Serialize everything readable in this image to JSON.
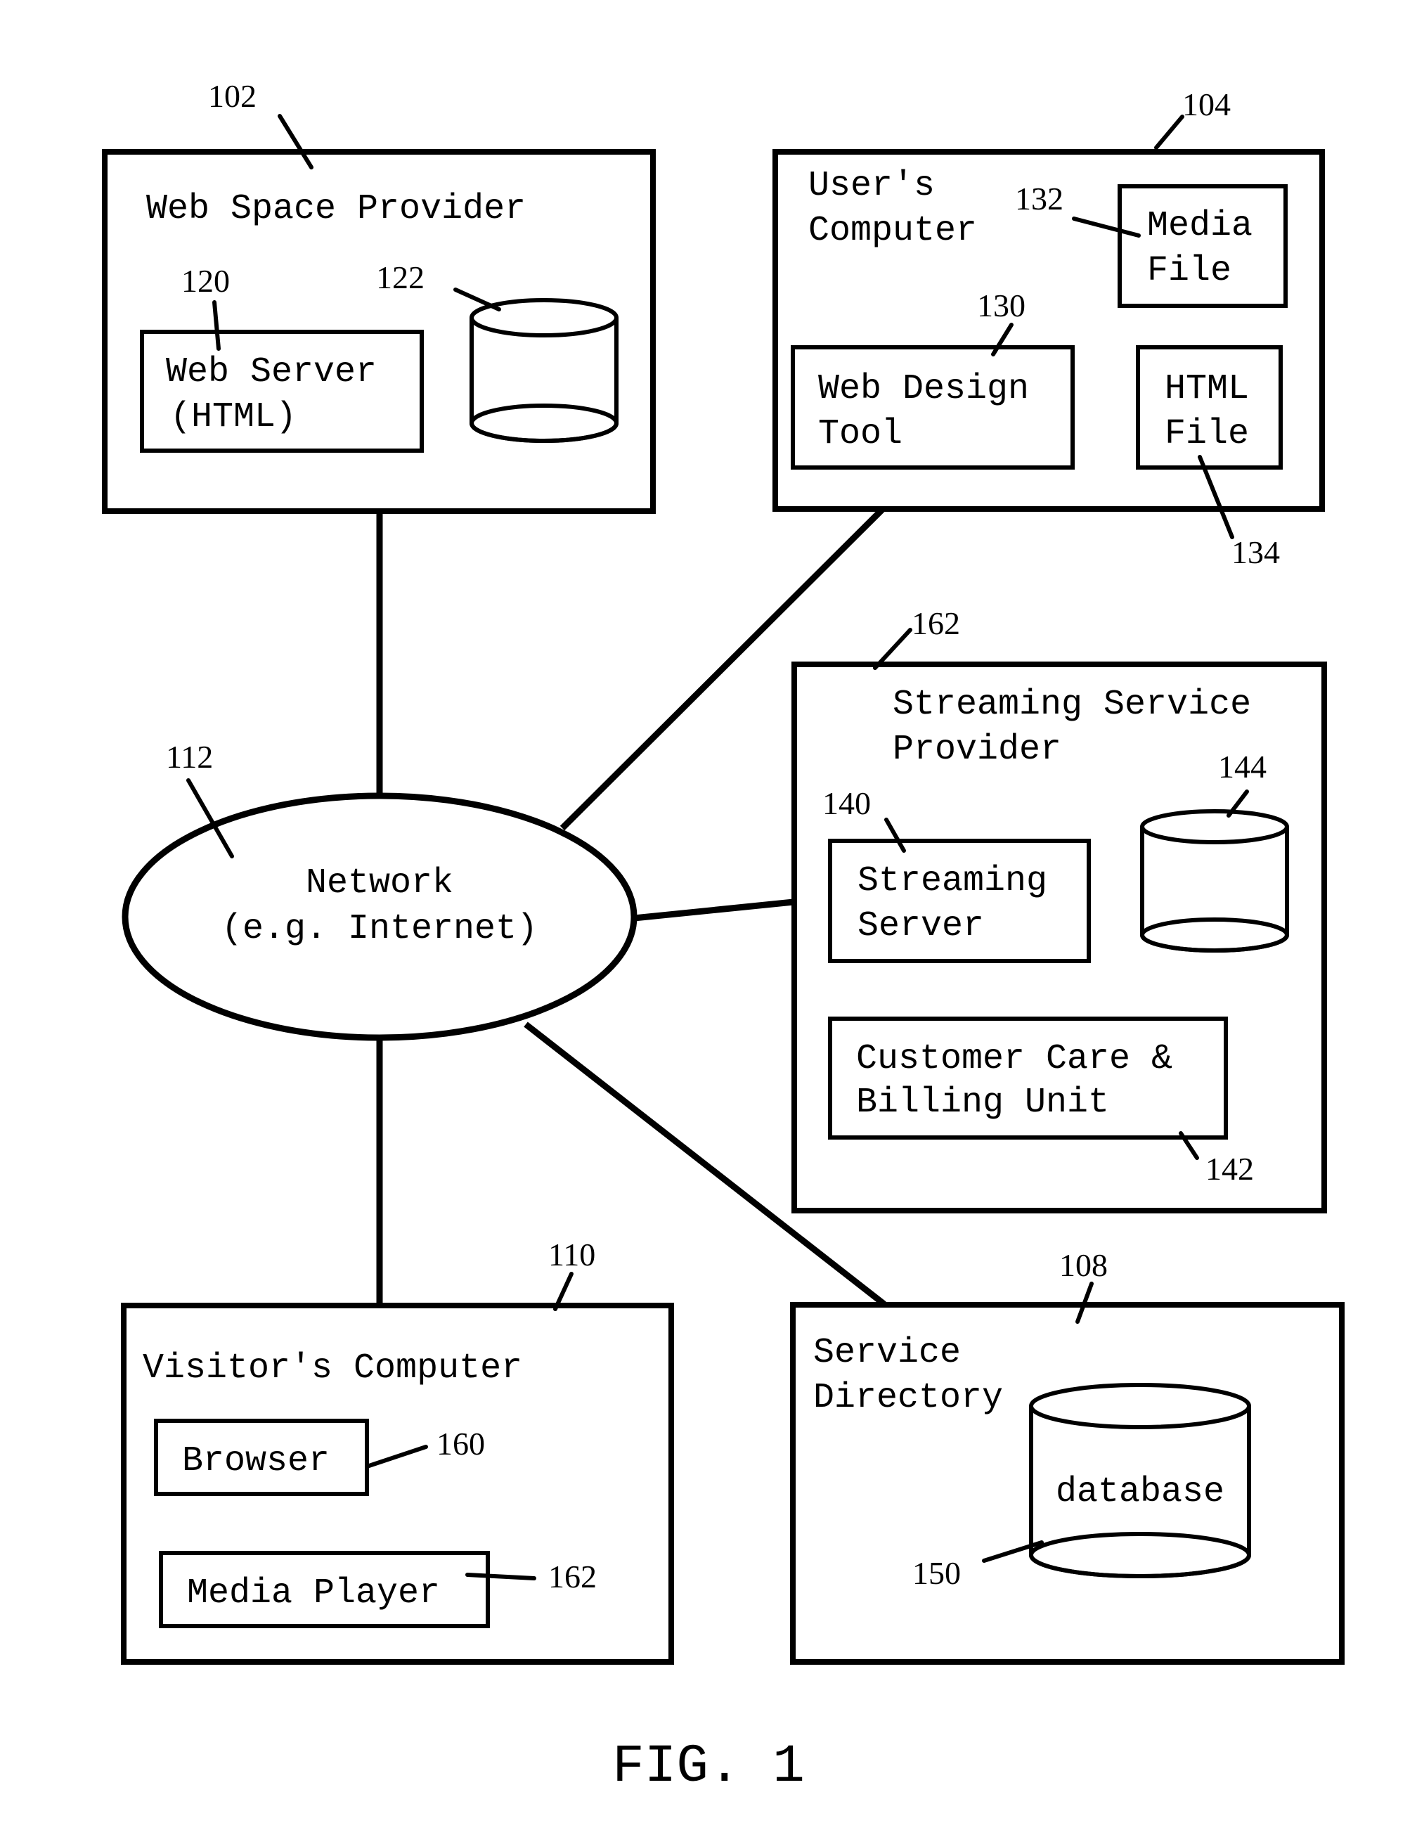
{
  "figure": {
    "caption": "FIG. 1"
  },
  "network": {
    "ref": "112",
    "line1": "Network",
    "line2": "(e.g. Internet)"
  },
  "web_space_provider": {
    "ref": "102",
    "title": "Web Space Provider",
    "web_server": {
      "ref": "120",
      "line1": "Web Server",
      "line2": "(HTML)"
    },
    "storage": {
      "ref": "122"
    }
  },
  "users_computer": {
    "ref": "104",
    "title_line1": "User's",
    "title_line2": "Computer",
    "media_file": {
      "ref": "132",
      "line1": "Media",
      "line2": "File"
    },
    "web_design_tool": {
      "ref": "130",
      "line1": "Web Design",
      "line2": "Tool"
    },
    "html_file": {
      "ref": "134",
      "line1": "HTML",
      "line2": "File"
    }
  },
  "streaming_service_provider": {
    "ref": "162",
    "title_line1": "Streaming Service",
    "title_line2": "Provider",
    "streaming_server": {
      "ref": "140",
      "line1": "Streaming",
      "line2": "Server"
    },
    "storage": {
      "ref": "144"
    },
    "billing_unit": {
      "ref": "142",
      "line1": "Customer Care &",
      "line2": "Billing Unit"
    }
  },
  "visitors_computer": {
    "ref": "110",
    "title": "Visitor's Computer",
    "browser": {
      "ref": "160",
      "label": "Browser"
    },
    "media_player": {
      "ref": "162",
      "label": "Media Player"
    }
  },
  "service_directory": {
    "ref": "108",
    "title_line1": "Service",
    "title_line2": "Directory",
    "database": {
      "ref": "150",
      "label": "database"
    }
  }
}
